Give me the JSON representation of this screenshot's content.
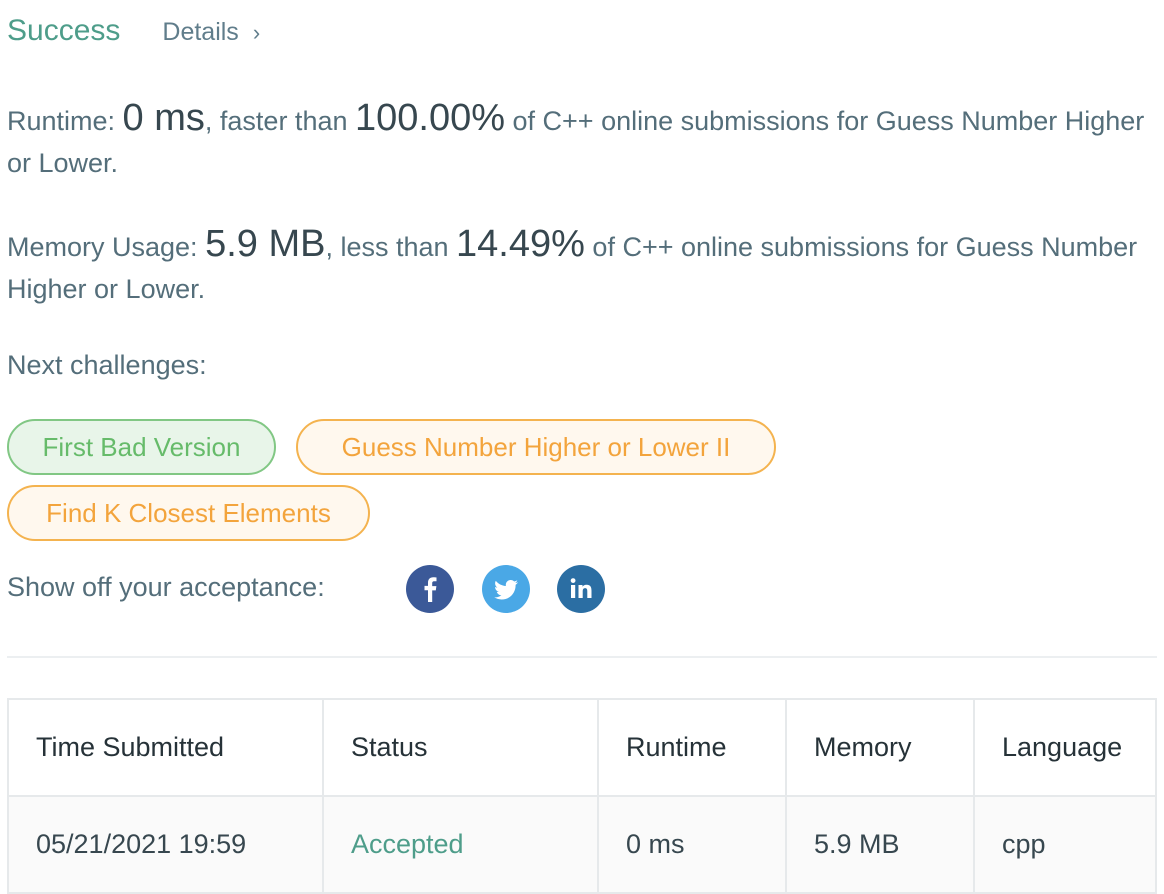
{
  "header": {
    "status": "Success",
    "details_label": "Details",
    "chevron": "›"
  },
  "runtime": {
    "label": "Runtime: ",
    "value": "0 ms",
    "comparison": ", faster than ",
    "percent": "100.00%",
    "suffix": " of C++ online submissions for Guess Number Higher or Lower."
  },
  "memory": {
    "label": "Memory Usage: ",
    "value": "5.9 MB",
    "comparison": ", less than ",
    "percent": "14.49%",
    "suffix": " of C++ online submissions for Guess Number Higher or Lower."
  },
  "next_challenges": {
    "label": "Next challenges:",
    "items": [
      {
        "label": "First Bad Version",
        "difficulty": "easy"
      },
      {
        "label": "Guess Number Higher or Lower II",
        "difficulty": "medium"
      },
      {
        "label": "Find K Closest Elements",
        "difficulty": "medium"
      }
    ]
  },
  "share": {
    "label": "Show off your acceptance:",
    "icons": [
      "facebook-icon",
      "twitter-icon",
      "linkedin-icon"
    ]
  },
  "submissions": {
    "headers": [
      "Time Submitted",
      "Status",
      "Runtime",
      "Memory",
      "Language"
    ],
    "rows": [
      [
        "05/21/2021 19:59",
        "Accepted",
        "0 ms",
        "5.9 MB",
        "cpp"
      ]
    ]
  },
  "colors": {
    "success_green": "#4e9d8a",
    "easy_green": "#66bb6a",
    "medium_orange": "#f3a43c",
    "facebook": "#3b5998",
    "twitter": "#4aa8e6",
    "linkedin": "#2b6ea3"
  }
}
